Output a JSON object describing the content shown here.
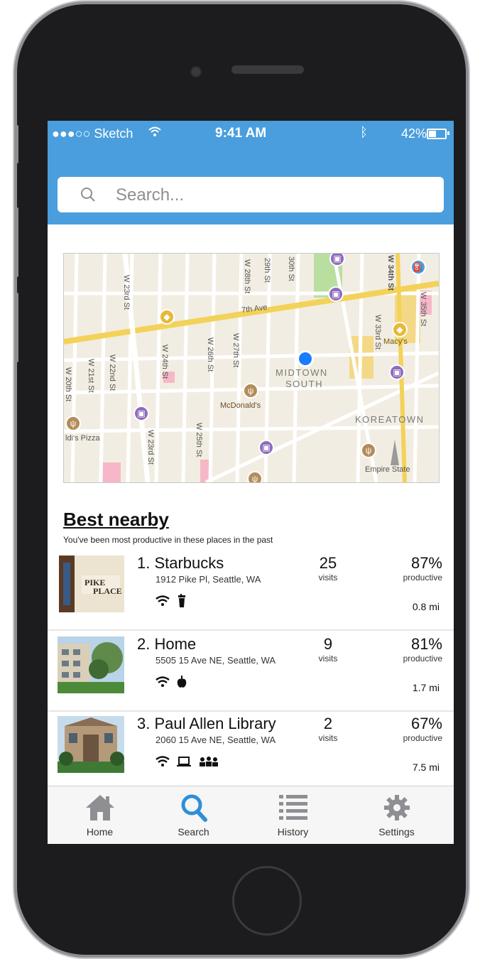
{
  "status_bar": {
    "carrier": "●●●○○ Sketch",
    "time": "9:41 AM",
    "battery": "42%"
  },
  "search": {
    "placeholder": "Search..."
  },
  "map": {
    "streets": [
      "W 23rd St",
      "7th Ave",
      "W 28th St",
      "29th St",
      "30th St",
      "W 34th St",
      "W 35th St",
      "W 33rd St",
      "W 24th St",
      "W 26th St",
      "W 27th St",
      "W 21st St",
      "W 22nd St",
      "W 20th St",
      "W 23rd St",
      "W 25th St"
    ],
    "places": [
      "Macy's",
      "McDonald's",
      "MIDTOWN",
      "SOUTH",
      "KOREATOWN",
      "Empire State",
      "ldi's Pizza"
    ]
  },
  "best_nearby": {
    "title": "Best nearby",
    "subtitle": "You've been most productive in these places in the past",
    "items": [
      {
        "name": "1. Starbucks",
        "address": "1912 Pike Pl, Seattle, WA",
        "visits": "25",
        "visits_label": "visits",
        "productive": "87%",
        "productive_label": "productive",
        "distance": "0.8 mi",
        "amenities": [
          "wifi-icon",
          "coffee-icon"
        ]
      },
      {
        "name": "2. Home",
        "address": "5505 15 Ave NE, Seattle, WA",
        "visits": "9",
        "visits_label": "visits",
        "productive": "81%",
        "productive_label": "productive",
        "distance": "1.7 mi",
        "amenities": [
          "wifi-icon",
          "apple-icon"
        ]
      },
      {
        "name": "3. Paul Allen Library",
        "address": "2060 15 Ave NE, Seattle, WA",
        "visits": "2",
        "visits_label": "visits",
        "productive": "67%",
        "productive_label": "productive",
        "distance": "7.5 mi",
        "amenities": [
          "wifi-icon",
          "laptop-icon",
          "group-icon"
        ]
      }
    ]
  },
  "tabbar": {
    "tabs": [
      {
        "label": "Home",
        "icon": "home-icon"
      },
      {
        "label": "Search",
        "icon": "search-icon",
        "active": true
      },
      {
        "label": "History",
        "icon": "list-icon"
      },
      {
        "label": "Settings",
        "icon": "gear-icon"
      }
    ]
  },
  "colors": {
    "accent": "#4a9edd",
    "active_tab": "#2e8fd8",
    "inactive_tab": "#8e8e93"
  }
}
